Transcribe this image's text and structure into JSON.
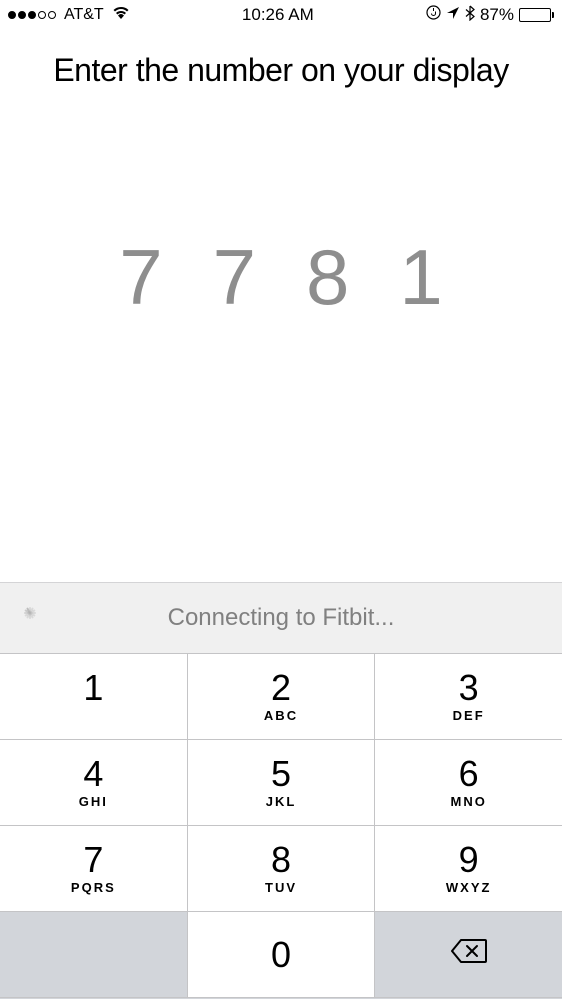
{
  "status_bar": {
    "signal_filled": 3,
    "signal_total": 5,
    "carrier": "AT&T",
    "time": "10:26 AM",
    "battery_percent": "87%"
  },
  "header": "Enter the number on your display",
  "entered_digits": [
    "7",
    "7",
    "8",
    "1"
  ],
  "connecting_status": "Connecting to Fitbit...",
  "keypad": {
    "rows": [
      [
        {
          "digit": "1",
          "letters": ""
        },
        {
          "digit": "2",
          "letters": "ABC"
        },
        {
          "digit": "3",
          "letters": "DEF"
        }
      ],
      [
        {
          "digit": "4",
          "letters": "GHI"
        },
        {
          "digit": "5",
          "letters": "JKL"
        },
        {
          "digit": "6",
          "letters": "MNO"
        }
      ],
      [
        {
          "digit": "7",
          "letters": "PQRS"
        },
        {
          "digit": "8",
          "letters": "TUV"
        },
        {
          "digit": "9",
          "letters": "WXYZ"
        }
      ],
      [
        {
          "digit": "",
          "letters": "",
          "blank": true
        },
        {
          "digit": "0",
          "letters": ""
        },
        {
          "digit": "",
          "letters": "",
          "delete": true
        }
      ]
    ]
  }
}
